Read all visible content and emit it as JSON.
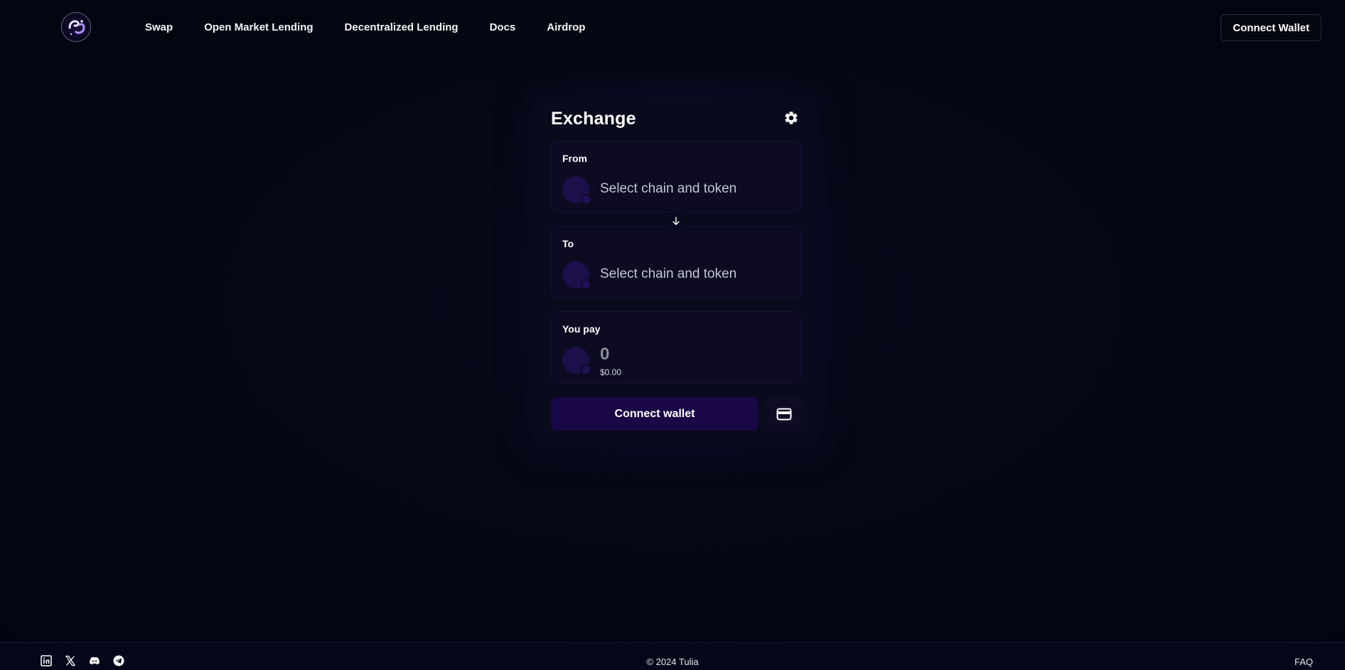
{
  "nav": {
    "items": [
      {
        "label": "Swap"
      },
      {
        "label": "Open Market Lending"
      },
      {
        "label": "Decentralized Lending"
      },
      {
        "label": "Docs"
      },
      {
        "label": "Airdrop"
      }
    ],
    "connect_wallet": "Connect Wallet"
  },
  "exchange": {
    "title": "Exchange",
    "from": {
      "label": "From",
      "placeholder": "Select chain and token"
    },
    "to": {
      "label": "To",
      "placeholder": "Select chain and token"
    },
    "pay": {
      "label": "You pay",
      "amount": "0",
      "usd": "$0.00"
    },
    "connect_button": "Connect wallet"
  },
  "footer": {
    "socials": [
      "linkedin-icon",
      "x-icon",
      "discord-icon",
      "telegram-icon"
    ],
    "copyright": "© 2024 Tulia",
    "faq": "FAQ"
  },
  "colors": {
    "background": "#030712",
    "card": "#090a1b",
    "panel": "#0c0b22",
    "accent_button": "#1a0746",
    "token_placeholder": "#1c0f4a"
  }
}
